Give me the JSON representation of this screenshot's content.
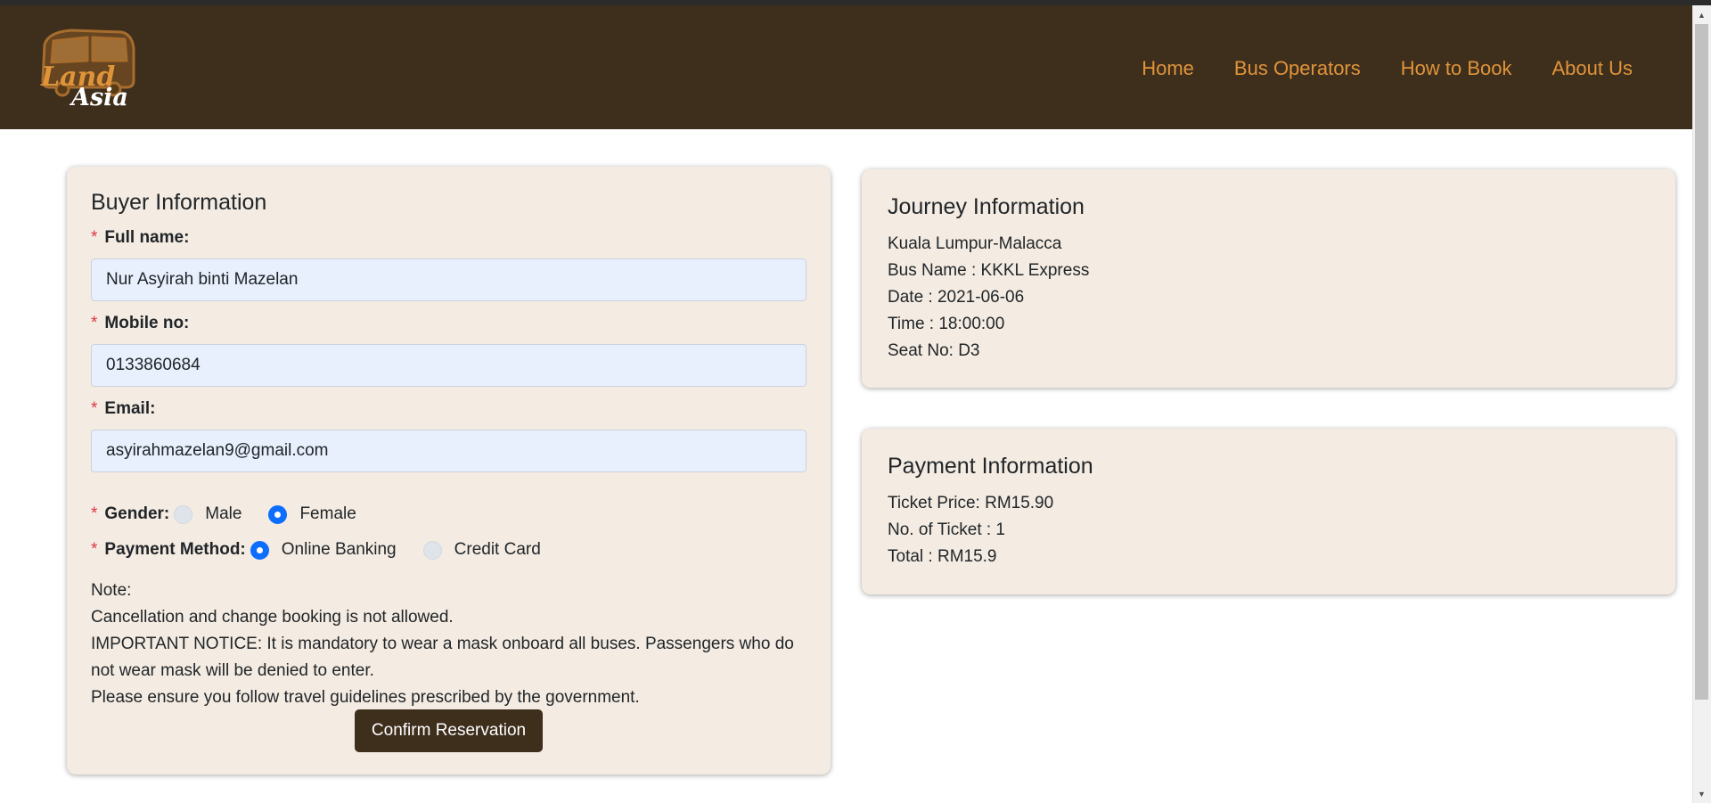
{
  "brand": {
    "logo_text_top": "Land",
    "logo_text_bottom": "Asia",
    "colors": {
      "navbar": "#3e2e1c",
      "nav_link": "#e0943a",
      "card_bg": "#f4ece2",
      "input_bg": "#e8f0fe",
      "required": "#dc3545",
      "radio_checked": "#0d6efd"
    }
  },
  "nav": {
    "items": [
      "Home",
      "Bus Operators",
      "How to Book",
      "About Us"
    ]
  },
  "buyer": {
    "title": "Buyer Information",
    "required_mark": "*",
    "full_name_label": "Full name:",
    "full_name_value": "Nur Asyirah binti Mazelan",
    "mobile_label": "Mobile no:",
    "mobile_value": "0133860684",
    "email_label": "Email:",
    "email_value": "asyirahmazelan9@gmail.com",
    "gender_label": "Gender:",
    "gender_options": [
      "Male",
      "Female"
    ],
    "gender_selected": "Female",
    "payment_label": "Payment Method:",
    "payment_options": [
      "Online Banking",
      "Credit Card"
    ],
    "payment_selected": "Online Banking",
    "notes": [
      "Note:",
      "Cancellation and change booking is not allowed.",
      "IMPORTANT NOTICE: It is mandatory to wear a mask onboard all buses. Passengers who do not wear mask will be denied to enter.",
      "Please ensure you follow travel guidelines prescribed by the government."
    ],
    "confirm_label": "Confirm Reservation"
  },
  "journey": {
    "title": "Journey Information",
    "route": "Kuala Lumpur-Malacca",
    "bus_name": "Bus Name : KKKL Express",
    "date": "Date : 2021-06-06",
    "time": "Time : 18:00:00",
    "seat": "Seat No: D3"
  },
  "payment": {
    "title": "Payment Information",
    "ticket_price": "Ticket Price: RM15.90",
    "ticket_count": "No. of Ticket : 1",
    "total": "Total : RM15.9"
  }
}
